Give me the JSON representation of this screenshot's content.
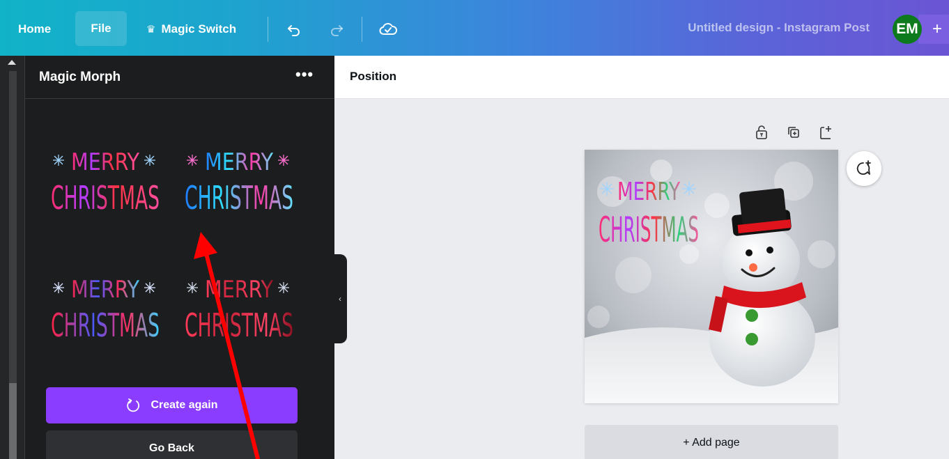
{
  "topbar": {
    "home_label": "Home",
    "file_label": "File",
    "magic_switch_label": "Magic Switch",
    "design_title": "Untitled design - Instagram Post",
    "avatar_initials": "EM",
    "plus_label": "+"
  },
  "panel": {
    "title": "Magic Morph",
    "more_label": "•••",
    "variants": [
      {
        "line1": "MERRY",
        "line2": "CHRISTMAS"
      },
      {
        "line1": "MERRY",
        "line2": "CHRISTMAS"
      },
      {
        "line1": "MERRY",
        "line2": "CHRISTMAS"
      },
      {
        "line1": "MERRY",
        "line2": "CHRISTMAS"
      }
    ],
    "create_again_label": "Create again",
    "go_back_label": "Go Back",
    "collapse_label": "‹"
  },
  "context_bar": {
    "position_label": "Position"
  },
  "canvas": {
    "design_text_line1": "MERRY",
    "design_text_line2": "CHRISTMAS",
    "add_page_label": "+ Add page"
  },
  "colors": {
    "accent_purple": "#8b3dff",
    "annotation_red": "#ff0000",
    "avatar_green": "#0e7a1e"
  }
}
